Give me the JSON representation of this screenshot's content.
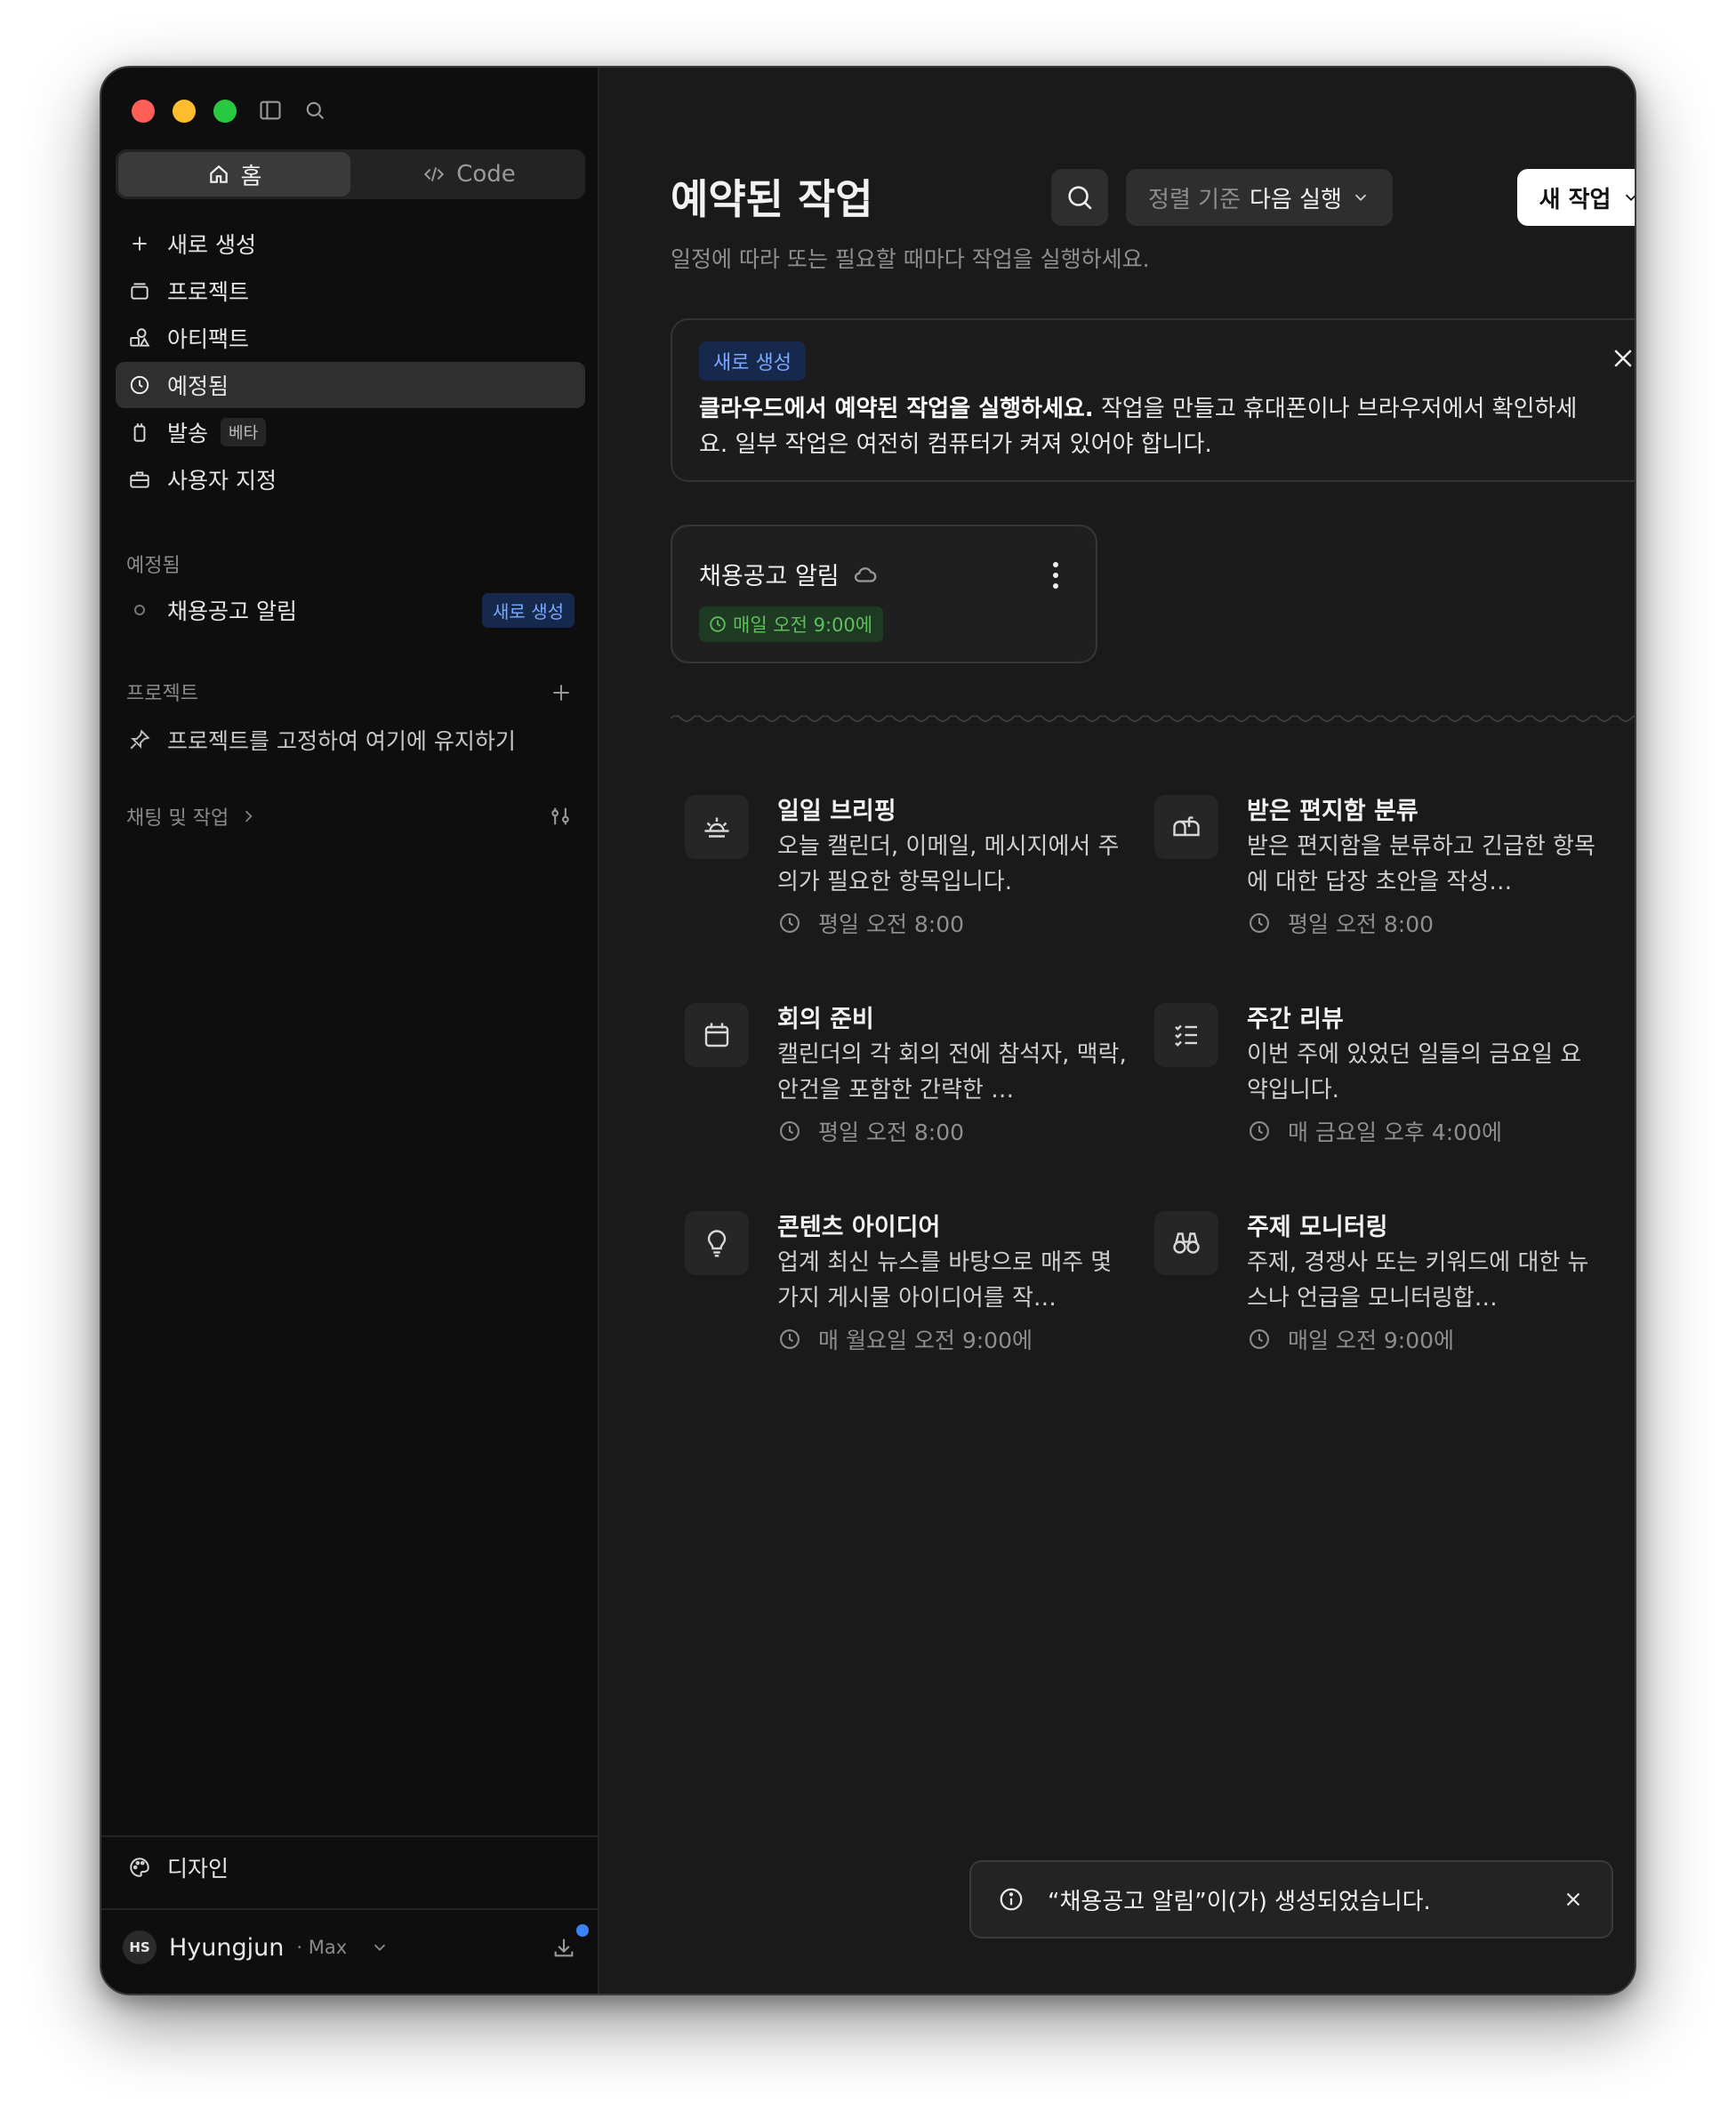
{
  "sidebar": {
    "seg": {
      "home": "홈",
      "code": "Code"
    },
    "nav": [
      {
        "label": "새로 생성",
        "icon": "plus-icon"
      },
      {
        "label": "프로젝트",
        "icon": "folder-icon"
      },
      {
        "label": "아티팩트",
        "icon": "shapes-icon"
      },
      {
        "label": "예정됨",
        "icon": "clock-icon",
        "active": true
      },
      {
        "label": "발송",
        "icon": "device-icon",
        "badge": "베타"
      },
      {
        "label": "사용자 지정",
        "icon": "briefcase-icon"
      }
    ],
    "scheduled_section": "예정됨",
    "scheduled_item": {
      "label": "채용공고 알림",
      "badge": "새로 생성"
    },
    "projects_section": "프로젝트",
    "pin_hint": "프로젝트를 고정하여 여기에 유지하기",
    "chats_section": "채팅 및 작업",
    "design": "디자인",
    "user": {
      "initials": "HS",
      "name": "Hyungjun",
      "plan": "· Max"
    }
  },
  "main": {
    "title": "예약된 작업",
    "subtitle": "일정에 따라 또는 필요할 때마다 작업을 실행하세요.",
    "sort": {
      "prefix": "정렬 기준",
      "value": "다음 실행"
    },
    "new_task": "새 작업",
    "banner": {
      "badge": "새로 생성",
      "bold": "클라우드에서 예약된 작업을 실행하세요.",
      "rest": " 작업을 만들고 휴대폰이나 브라우저에서 확인하세요. 일부 작업은 여전히 컴퓨터가 켜져 있어야 합니다."
    },
    "job": {
      "title": "채용공고 알림",
      "schedule": "매일 오전 9:00에"
    },
    "templates": [
      {
        "title": "일일 브리핑",
        "desc": "오늘 캘린더, 이메일, 메시지에서 주의가 필요한 항목입니다.",
        "time": "평일 오전 8:00",
        "icon": "sunrise-icon"
      },
      {
        "title": "받은 편지함 분류",
        "desc": "받은 편지함을 분류하고 긴급한 항목에 대한 답장 초안을 작성…",
        "time": "평일 오전 8:00",
        "icon": "mailbox-icon"
      },
      {
        "title": "회의 준비",
        "desc": "캘린더의 각 회의 전에 참석자, 맥락, 안건을 포함한 간략한 …",
        "time": "평일 오전 8:00",
        "icon": "calendar-icon"
      },
      {
        "title": "주간 리뷰",
        "desc": "이번 주에 있었던 일들의 금요일 요약입니다.",
        "time": "매 금요일 오후 4:00에",
        "icon": "checklist-icon"
      },
      {
        "title": "콘텐츠 아이디어",
        "desc": "업계 최신 뉴스를 바탕으로 매주 몇 가지 게시물 아이디어를 작…",
        "time": "매 월요일 오전 9:00에",
        "icon": "lightbulb-icon"
      },
      {
        "title": "주제 모니터링",
        "desc": "주제, 경쟁사 또는 키워드에 대한 뉴스나 언급을 모니터링합…",
        "time": "매일 오전 9:00에",
        "icon": "binoculars-icon"
      }
    ],
    "toast": "“채용공고 알림”이(가) 생성되었습니다."
  }
}
